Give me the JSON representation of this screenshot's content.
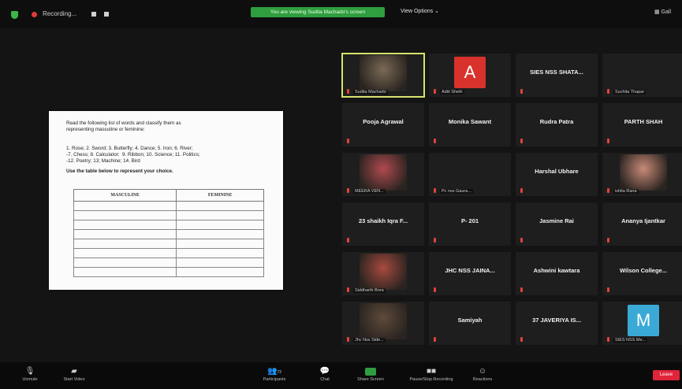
{
  "topbar": {
    "recording_label": "Recording...",
    "share_banner": "You are viewing Sudita Machado's screen",
    "view_options": "View Options ⌄",
    "gallery_label": "▦ Gall"
  },
  "document": {
    "instruction_line1": "Read the following list of words and classify them as",
    "instruction_line2": "representing masculine or feminine:",
    "words_line1": "1. Rose; 2. Sword; 3. Butterfly; 4. Dance; 5. Iron; 6. River;",
    "words_line2": "-7. Chess; 8. Calculator;  9. Ribbon; 10. Science; 11. Politics;",
    "words_line3": "-12. Poetry; 13; Machine; 14. Bird",
    "table_line": "Use the table below to represent your choice.",
    "table_headers": [
      "MASCULINE",
      "FEMININE"
    ]
  },
  "participants": [
    {
      "name": "Sudita Machado",
      "kind": "video",
      "active": true,
      "video_color": "#7a6a55"
    },
    {
      "name": "Aditi Sheth",
      "kind": "avatar",
      "letter": "A",
      "avatar_color": "#d9322c"
    },
    {
      "name": "SIES NSS SHATA...",
      "kind": "big"
    },
    {
      "name": "Suchita Thapar",
      "kind": "small"
    },
    {
      "name": "Pooja Agrawal",
      "kind": "big"
    },
    {
      "name": "Monika Sawant",
      "kind": "big"
    },
    {
      "name": "Rudra Patra",
      "kind": "big"
    },
    {
      "name": "PARTH SHAH",
      "kind": "big"
    },
    {
      "name": "MEERA VEN...",
      "kind": "video",
      "video_color": "#b14a4f"
    },
    {
      "name": "Pc nss Gaura...",
      "kind": "small"
    },
    {
      "name": "Harshal Ubhare",
      "kind": "big"
    },
    {
      "name": "ishita Rana",
      "kind": "video",
      "video_color": "#c98a78"
    },
    {
      "name": "23 shaikh Iqra F...",
      "kind": "big"
    },
    {
      "name": "P- 201",
      "kind": "big"
    },
    {
      "name": "Jasmine Rai",
      "kind": "big"
    },
    {
      "name": "Ananya Ijantkar",
      "kind": "big"
    },
    {
      "name": "Siddharth Bora",
      "kind": "video",
      "video_color": "#a84a3e"
    },
    {
      "name": "JHC NSS JAINA...",
      "kind": "big"
    },
    {
      "name": "Ashwini kawtara",
      "kind": "big"
    },
    {
      "name": "Wilson College...",
      "kind": "big"
    },
    {
      "name": "Jhc Nss Side...",
      "kind": "video",
      "video_color": "#5e4a3a"
    },
    {
      "name": "Samiyah",
      "kind": "big"
    },
    {
      "name": "37 JAVERIYA IS...",
      "kind": "big"
    },
    {
      "name": "SIES NSS Me...",
      "kind": "avatar",
      "letter": "M",
      "avatar_color": "#3ba9d6"
    }
  ],
  "toolbar": {
    "unmute": "Unmute",
    "start_video": "Start Video",
    "participants": "Participants",
    "participants_count": "72",
    "chat": "Chat",
    "share_screen": "Share Screen",
    "pause_recording": "Pause/Stop Recording",
    "reactions": "Reactions",
    "leave": "Leave"
  }
}
